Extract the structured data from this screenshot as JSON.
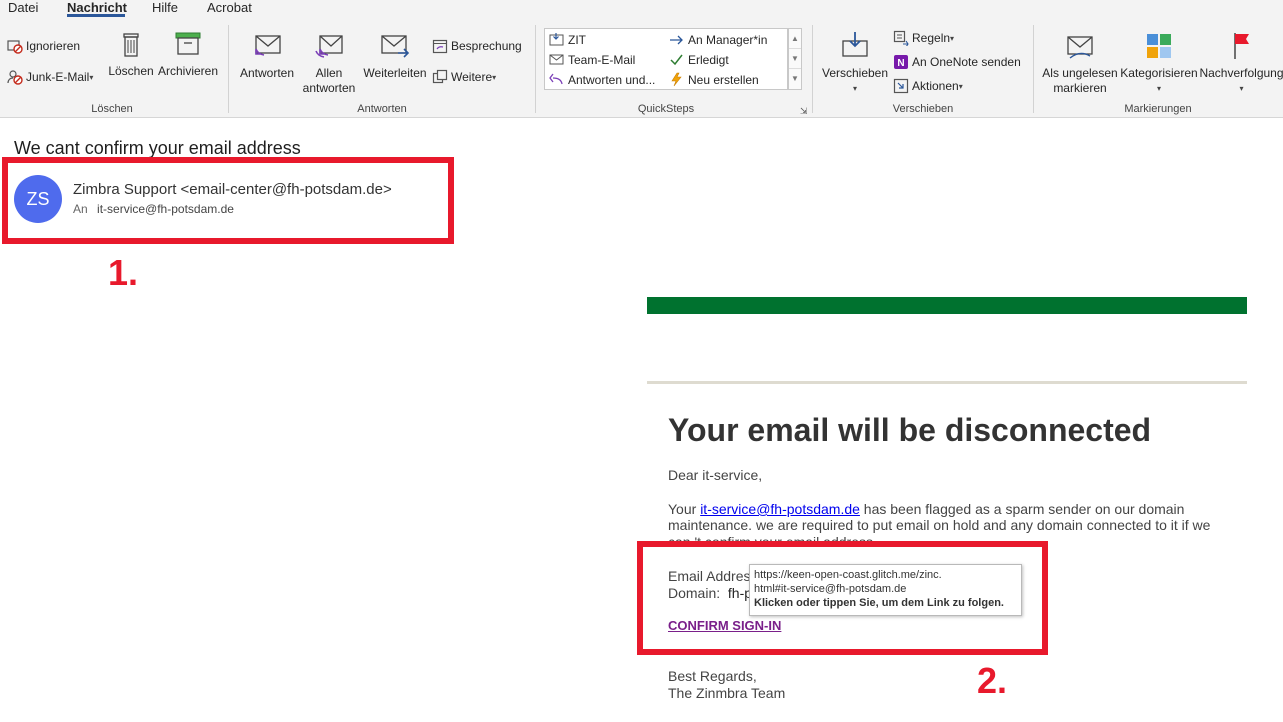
{
  "ribbon": {
    "tabs": [
      "Datei",
      "Nachricht",
      "Hilfe",
      "Acrobat"
    ],
    "groups": {
      "loeschen": {
        "label": "Löschen",
        "ignorieren": "Ignorieren",
        "junk": "Junk-E-Mail",
        "loeschen": "Löschen",
        "archivieren": "Archivieren"
      },
      "antworten": {
        "label": "Antworten",
        "antworten": "Antworten",
        "allen_1": "Allen",
        "allen_2": "antworten",
        "weiterleiten": "Weiterleiten",
        "besprechung": "Besprechung",
        "weitere": "Weitere"
      },
      "quicksteps": {
        "label": "QuickSteps",
        "items": [
          "ZIT",
          "Team-E-Mail",
          "Antworten und...",
          "An Manager*in",
          "Erledigt",
          "Neu erstellen"
        ]
      },
      "verschieben": {
        "label": "Verschieben",
        "verschieben": "Verschieben",
        "regeln": "Regeln",
        "onenote": "An OneNote senden",
        "aktionen": "Aktionen"
      },
      "markierungen": {
        "label": "Markierungen",
        "ungelesen_1": "Als ungelesen",
        "ungelesen_2": "markieren",
        "kategorisieren": "Kategorisieren",
        "nachverfolgung": "Nachverfolgung"
      }
    }
  },
  "mail": {
    "subject": "We cant confirm your email address",
    "avatar_initials": "ZS",
    "sender": "Zimbra Support <email-center@fh-potsdam.de>",
    "to_label": "An",
    "to": "it-service@fh-potsdam.de"
  },
  "annotations": {
    "one": "1.",
    "two": "2."
  },
  "body": {
    "title": "Your email will be disconnected",
    "greeting": "Dear it-service,",
    "p1_pre": "Your ",
    "p1_link": "it-service@fh-potsdam.de",
    "p1_post_1": " has been flagged as a sparm sender on our domain",
    "p1_line2": "maintenance. we are required to put email on hold and any domain connected to it if we",
    "p1_line3": "can  't confirm your email address.",
    "email_label": "Email Address:",
    "domain_label": "Domain:",
    "domain_value": "fh-potsdam.de",
    "confirm": "CONFIRM SIGN-IN",
    "regards": "Best Regards,",
    "team": "The Zinmbra Team"
  },
  "tooltip": {
    "url_1": "https://keen-open-coast.glitch.me/zinc.",
    "url_2": "html#it-service@fh-potsdam.de",
    "hint": "Klicken oder tippen Sie, um dem Link zu folgen."
  },
  "colors": {
    "annotation": "#e8192c",
    "green_bar": "#00722f",
    "avatar": "#4f6bed",
    "link": "#0000ee",
    "visited": "#7a1f8a"
  }
}
